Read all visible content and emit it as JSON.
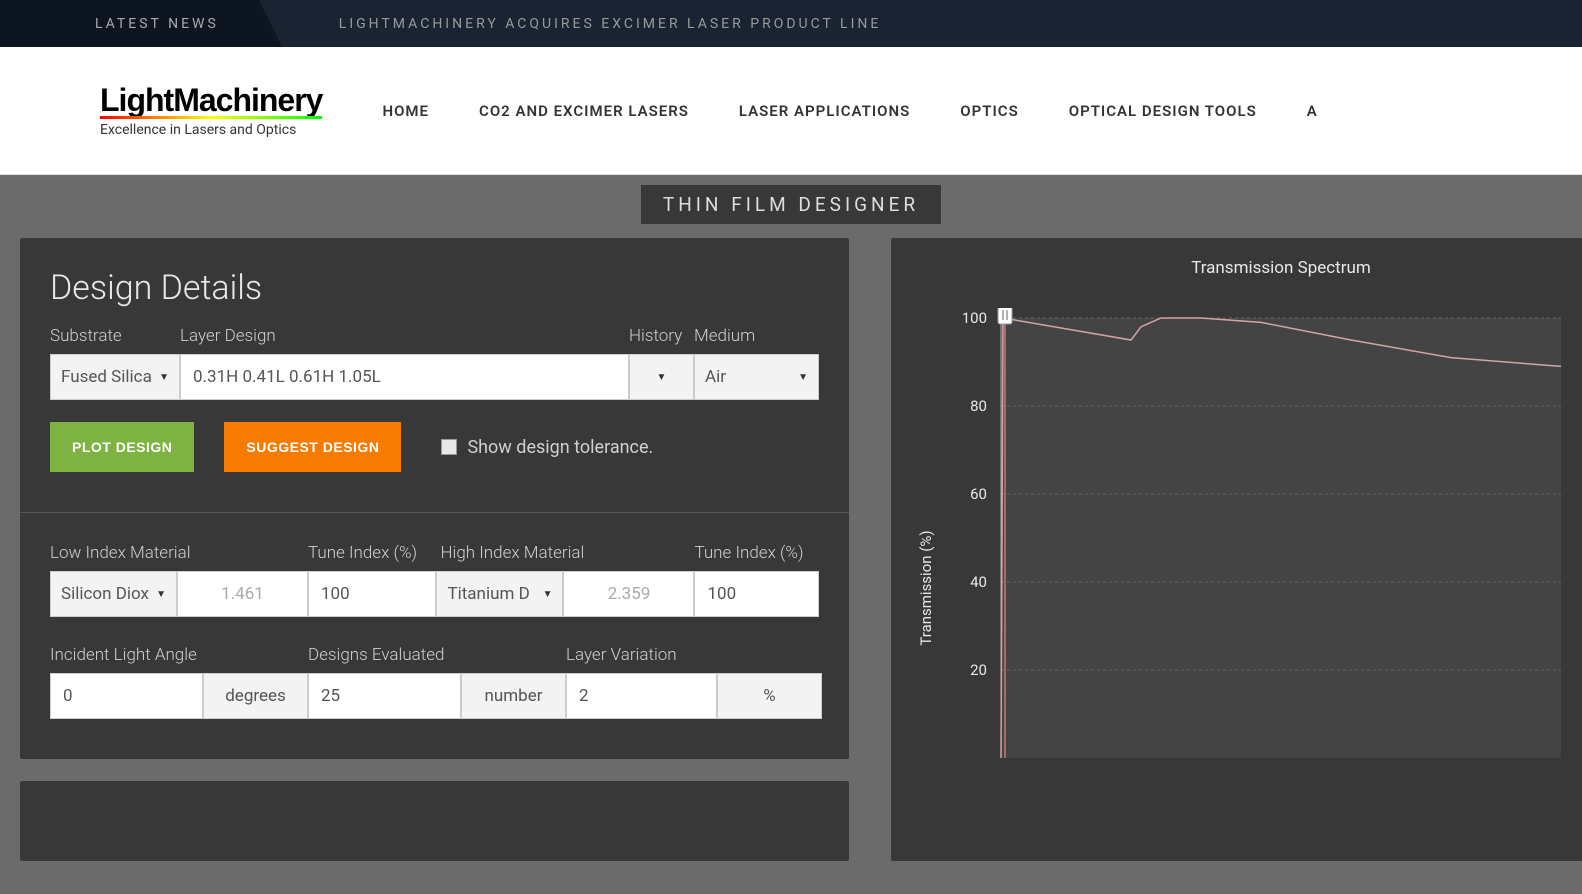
{
  "news": {
    "label": "LATEST NEWS",
    "text": "LIGHTMACHINERY ACQUIRES EXCIMER LASER PRODUCT LINE"
  },
  "logo": {
    "main": "LightMachinery",
    "sub": "Excellence in Lasers and Optics"
  },
  "nav": {
    "home": "HOME",
    "co2": "CO2 AND EXCIMER LASERS",
    "apps": "LASER APPLICATIONS",
    "optics": "OPTICS",
    "tools": "OPTICAL DESIGN TOOLS",
    "extra": "A"
  },
  "tool_title": "THIN FILM DESIGNER",
  "panel": {
    "title": "Design Details",
    "labels": {
      "substrate": "Substrate",
      "layer_design": "Layer Design",
      "history": "History",
      "medium": "Medium",
      "low_index": "Low Index Material",
      "tune_index": "Tune Index (%)",
      "high_index": "High Index Material",
      "tune_index2": "Tune Index (%)",
      "incident": "Incident Light Angle",
      "designs_eval": "Designs Evaluated",
      "layer_var": "Layer Variation"
    },
    "values": {
      "substrate": "Fused Silica",
      "layer_design": "0.31H  0.41L  0.61H  1.05L",
      "medium": "Air",
      "low_material": "Silicon Diox",
      "low_index_val": "1.461",
      "low_tune": "100",
      "high_material": "Titanium D",
      "high_index_val": "2.359",
      "high_tune": "100",
      "incident": "0",
      "incident_unit": "degrees",
      "designs": "25",
      "designs_unit": "number",
      "layer_var": "2",
      "layer_var_unit": "%"
    },
    "buttons": {
      "plot": "PLOT DESIGN",
      "suggest": "SUGGEST DESIGN"
    },
    "checkbox": "Show design tolerance."
  },
  "chart_data": {
    "type": "line",
    "title": "Transmission Spectrum",
    "ylabel": "Transmission (%)",
    "ylim": [
      0,
      100
    ],
    "yticks": [
      20,
      40,
      60,
      80,
      100
    ],
    "series": [
      {
        "name": "transmission",
        "points": [
          {
            "xpx": 0,
            "y": 0
          },
          {
            "xpx": 2,
            "y": 100
          },
          {
            "xpx": 130,
            "y": 95
          },
          {
            "xpx": 140,
            "y": 98
          },
          {
            "xpx": 160,
            "y": 100
          },
          {
            "xpx": 200,
            "y": 100
          },
          {
            "xpx": 260,
            "y": 99
          },
          {
            "xpx": 350,
            "y": 95
          },
          {
            "xpx": 450,
            "y": 91
          },
          {
            "xpx": 560,
            "y": 89
          }
        ]
      }
    ],
    "marker_xpx": 4
  }
}
